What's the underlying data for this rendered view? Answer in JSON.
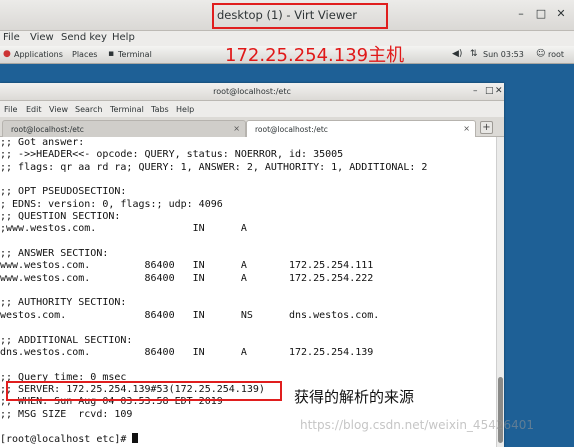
{
  "window": {
    "title": "desktop (1) - Virt Viewer",
    "controls": {
      "minimize": "–",
      "maximize": "□",
      "close": "✕"
    },
    "menu": [
      "File",
      "View",
      "Send key",
      "Help"
    ]
  },
  "guest_panel": {
    "applications": "Applications",
    "places": "Places",
    "terminal": "Terminal",
    "clock": "Sun 03:53",
    "user": "root"
  },
  "annotations": {
    "host": "172.25.254.139主机",
    "source": "获得的解析的来源"
  },
  "terminal": {
    "title": "root@localhost:/etc",
    "menu": [
      "File",
      "Edit",
      "View",
      "Search",
      "Terminal",
      "Tabs",
      "Help"
    ],
    "tabs": [
      "root@localhost:/etc",
      "root@localhost:/etc"
    ],
    "lines": [
      ";; Got answer:",
      ";; ->>HEADER<<- opcode: QUERY, status: NOERROR, id: 35005",
      ";; flags: qr aa rd ra; QUERY: 1, ANSWER: 2, AUTHORITY: 1, ADDITIONAL: 2",
      "",
      ";; OPT PSEUDOSECTION:",
      "; EDNS: version: 0, flags:; udp: 4096",
      ";; QUESTION SECTION:",
      ";www.westos.com.                IN      A",
      "",
      ";; ANSWER SECTION:",
      "www.westos.com.         86400   IN      A       172.25.254.111",
      "www.westos.com.         86400   IN      A       172.25.254.222",
      "",
      ";; AUTHORITY SECTION:",
      "westos.com.             86400   IN      NS      dns.westos.com.",
      "",
      ";; ADDITIONAL SECTION:",
      "dns.westos.com.         86400   IN      A       172.25.254.139",
      "",
      ";; Query time: 0 msec",
      ";; SERVER: 172.25.254.139#53(172.25.254.139)",
      ";; WHEN: Sun Aug 04 03:53:58 EDT 2019",
      ";; MSG SIZE  rcvd: 109",
      "",
      "[root@localhost etc]# "
    ]
  },
  "watermark": "https://blog.csdn.net/weixin_45426401"
}
